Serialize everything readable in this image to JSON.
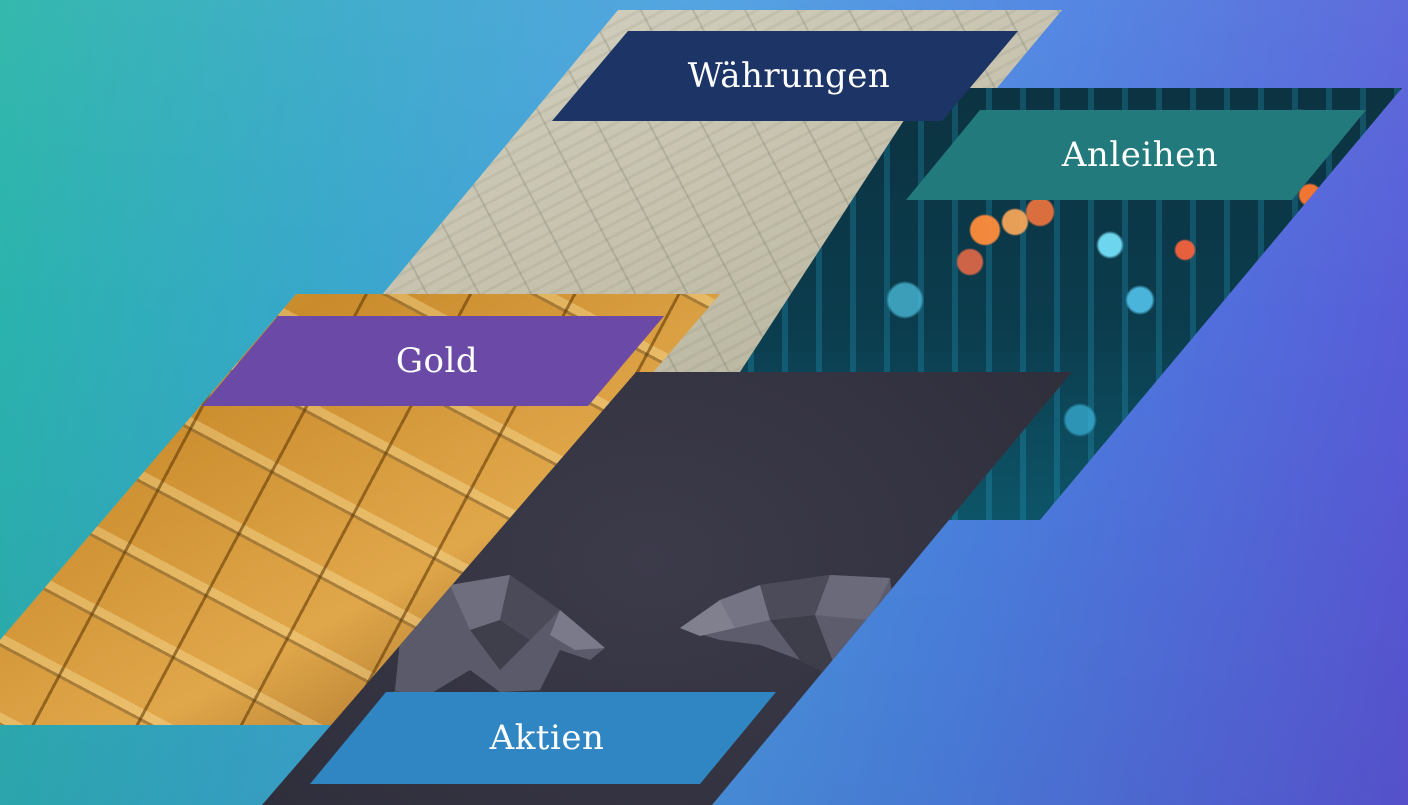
{
  "tiles": [
    {
      "id": "waehrungen",
      "label": "Währungen",
      "image": "money-bundles",
      "label_color": "#1c3566"
    },
    {
      "id": "anleihen",
      "label": "Anleihen",
      "image": "bokeh-lights",
      "label_color": "#227a7c"
    },
    {
      "id": "gold",
      "label": "Gold",
      "image": "gold-bars",
      "label_color": "#6a4aa6"
    },
    {
      "id": "aktien",
      "label": "Aktien",
      "image": "bull-and-bear",
      "label_color": "#2f86c2"
    }
  ],
  "background": {
    "from": "#28b4a8",
    "to": "#5a55d6"
  }
}
